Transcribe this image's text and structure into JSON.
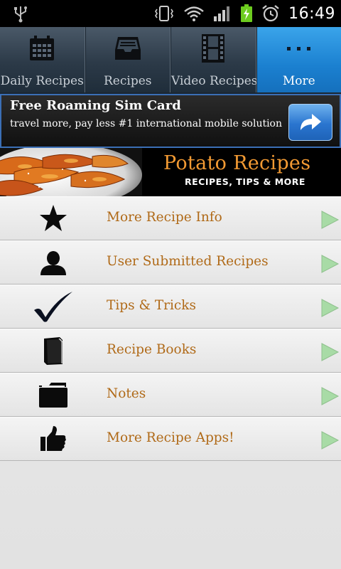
{
  "status_bar": {
    "time": "16:49",
    "icons": [
      "usb-icon",
      "vibrate-icon",
      "wifi-icon",
      "signal-icon",
      "battery-charging-icon",
      "alarm-icon"
    ]
  },
  "tabs": [
    {
      "label": "Daily Recipes",
      "icon": "calendar-icon",
      "active": false
    },
    {
      "label": "Recipes",
      "icon": "inbox-tray-icon",
      "active": false
    },
    {
      "label": "Video Recipes",
      "icon": "film-strip-icon",
      "active": false
    },
    {
      "label": "More",
      "icon": "more-dots-icon",
      "active": true
    }
  ],
  "ad": {
    "title": "Free Roaming Sim Card",
    "subtitle": "travel more, pay less #1 international mobile solution",
    "button_icon": "share-arrow-icon"
  },
  "header": {
    "title": "Potato Recipes",
    "subtitle": "RECIPES, TIPS & MORE"
  },
  "menu": {
    "items": [
      {
        "label": "More Recipe Info",
        "icon": "star-icon"
      },
      {
        "label": "User Submitted Recipes",
        "icon": "user-icon"
      },
      {
        "label": "Tips & Tricks",
        "icon": "checkmark-icon"
      },
      {
        "label": "Recipe Books",
        "icon": "book-icon"
      },
      {
        "label": "Notes",
        "icon": "folder-icon"
      },
      {
        "label": "More Recipe Apps!",
        "icon": "thumbs-up-icon"
      }
    ]
  },
  "colors": {
    "accent_tab": "#1b80d0",
    "menu_text": "#b06a18",
    "header_title": "#f29a33",
    "arrow": "#a8dba6"
  }
}
